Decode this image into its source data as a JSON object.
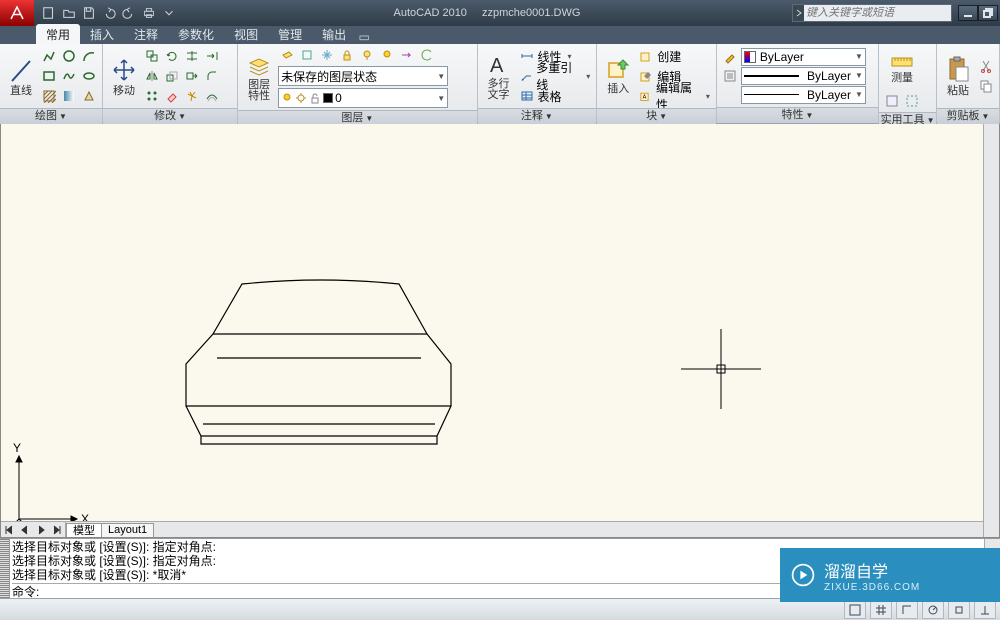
{
  "title": {
    "app": "AutoCAD 2010",
    "file": "zzpmche0001.DWG"
  },
  "search": {
    "placeholder": "键入关键字或短语"
  },
  "tabs": [
    "常用",
    "插入",
    "注释",
    "参数化",
    "视图",
    "管理",
    "输出"
  ],
  "active_tab": 0,
  "panels": {
    "draw": {
      "title": "绘图",
      "big_label": "直线"
    },
    "modify": {
      "title": "修改",
      "big_label": "移动"
    },
    "layer": {
      "title": "图层",
      "big_label": "图层",
      "big_sub": "特性",
      "combo": "未保存的图层状态",
      "current_color": "0"
    },
    "annotate": {
      "title": "注释",
      "big_label": "多行",
      "big_sub": "文字",
      "items": [
        "线性",
        "多重引线",
        "表格"
      ]
    },
    "block": {
      "title": "块",
      "big_label": "插入",
      "items": [
        "创建",
        "编辑",
        "编辑属性"
      ]
    },
    "props": {
      "title": "特性",
      "bylayer": "ByLayer"
    },
    "utils": {
      "title": "实用工具",
      "measure": "测量"
    },
    "clip": {
      "title": "剪贴板",
      "paste": "粘贴"
    }
  },
  "layout_tabs": [
    "模型",
    "Layout1"
  ],
  "ucs": {
    "x": "X",
    "y": "Y"
  },
  "cmd_lines": [
    "选择目标对象或 [设置(S)]: 指定对角点:",
    "选择目标对象或 [设置(S)]: 指定对角点:",
    "选择目标对象或 [设置(S)]: *取消*"
  ],
  "cmd_prompt": "命令:",
  "watermark": {
    "brand": "溜溜自学",
    "url": "ZIXUE.3D66.COM"
  }
}
